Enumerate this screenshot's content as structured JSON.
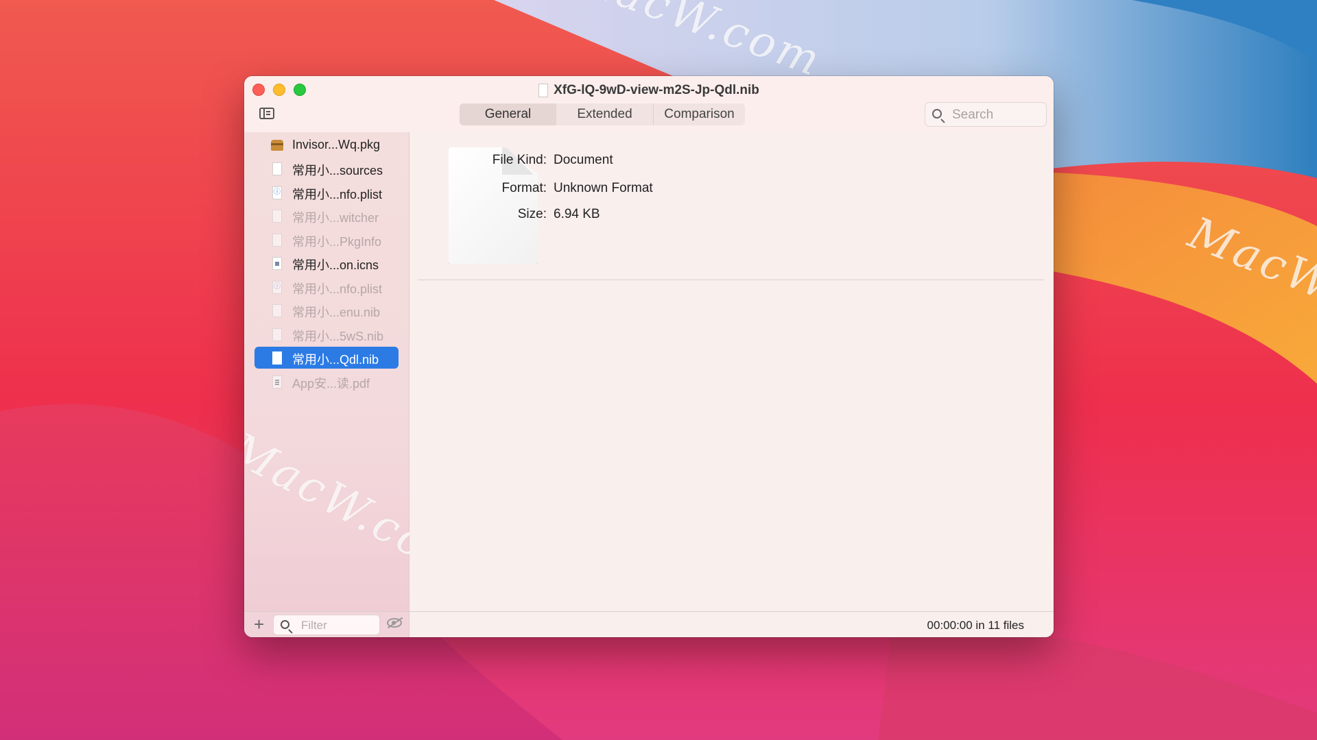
{
  "window": {
    "title": "XfG-lQ-9wD-view-m2S-Jp-Qdl.nib"
  },
  "tabs": [
    {
      "label": "General",
      "selected": true
    },
    {
      "label": "Extended",
      "selected": false
    },
    {
      "label": "Comparison",
      "selected": false
    }
  ],
  "search": {
    "placeholder": "Search"
  },
  "sidebar": {
    "items": [
      {
        "label": "Invisor...Wq.pkg",
        "icon": "package-icon",
        "dimmed": false,
        "selected": false
      },
      {
        "label": "常用小...sources",
        "icon": "document-icon",
        "dimmed": false,
        "selected": false
      },
      {
        "label": "常用小...nfo.plist",
        "icon": "plist-icon",
        "dimmed": false,
        "selected": false
      },
      {
        "label": "常用小...witcher",
        "icon": "document-icon",
        "dimmed": true,
        "selected": false
      },
      {
        "label": "常用小...PkgInfo",
        "icon": "document-icon",
        "dimmed": true,
        "selected": false
      },
      {
        "label": "常用小...on.icns",
        "icon": "icns-icon",
        "dimmed": false,
        "selected": false
      },
      {
        "label": "常用小...nfo.plist",
        "icon": "plist-icon",
        "dimmed": true,
        "selected": false
      },
      {
        "label": "常用小...enu.nib",
        "icon": "document-icon",
        "dimmed": true,
        "selected": false
      },
      {
        "label": "常用小...5wS.nib",
        "icon": "document-icon",
        "dimmed": true,
        "selected": false
      },
      {
        "label": "常用小...Qdl.nib",
        "icon": "document-icon",
        "dimmed": false,
        "selected": true
      },
      {
        "label": "App安...读.pdf",
        "icon": "pdf-icon",
        "dimmed": true,
        "selected": false
      }
    ],
    "filter_placeholder": "Filter"
  },
  "info": {
    "kind_label": "File Kind:",
    "kind_value": "Document",
    "format_label": "Format:",
    "format_value": "Unknown Format",
    "size_label": "Size:",
    "size_value": "6.94 KB"
  },
  "status": {
    "text": "00:00:00 in 11 files"
  },
  "watermarks": [
    "MacW.com",
    "MacW.co",
    "MacW.com"
  ],
  "colors": {
    "selection": "#2c7be5",
    "close": "#fe5f57",
    "minimize": "#febc2e",
    "maximize": "#28c840"
  }
}
